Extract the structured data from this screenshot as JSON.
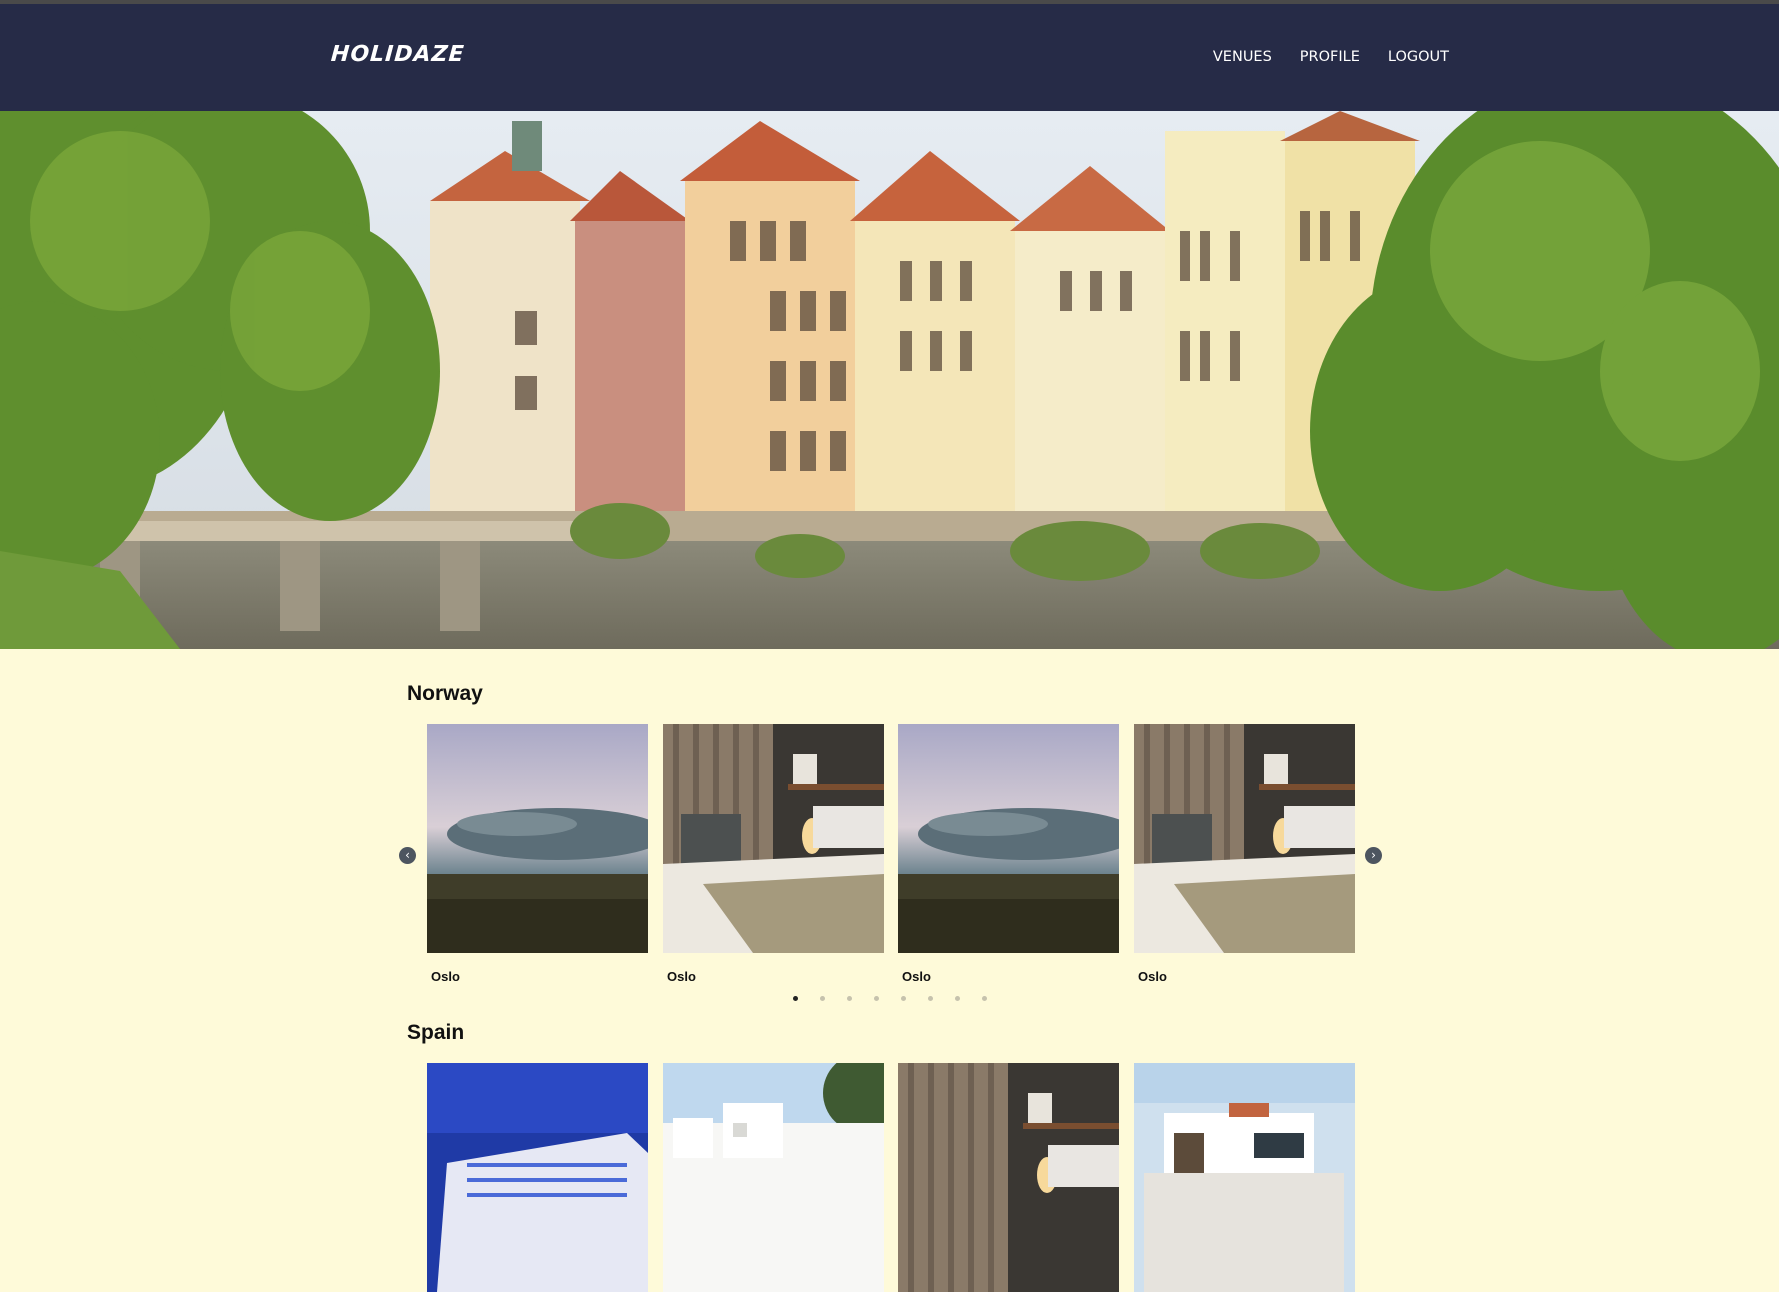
{
  "header": {
    "logo": "HOLIDAZE",
    "nav": [
      {
        "label": "VENUES"
      },
      {
        "label": "PROFILE"
      },
      {
        "label": "LOGOUT"
      }
    ]
  },
  "sections": [
    {
      "title": "Norway",
      "cards": [
        {
          "caption": "Oslo",
          "image": "stormy-field"
        },
        {
          "caption": "Oslo",
          "image": "hotel-bedroom"
        },
        {
          "caption": "Oslo",
          "image": "stormy-field"
        },
        {
          "caption": "Oslo",
          "image": "hotel-bedroom"
        }
      ],
      "carousel": {
        "page_count": 8,
        "active_page": 1
      }
    },
    {
      "title": "Spain",
      "cards": [
        {
          "image": "night-hotel"
        },
        {
          "image": "white-villa"
        },
        {
          "image": "hotel-bedroom"
        },
        {
          "image": "modern-house"
        }
      ]
    }
  ],
  "icons": {
    "prev": "chevron-left-icon",
    "next": "chevron-right-icon"
  },
  "colors": {
    "navbar": "#262b47",
    "page_background": "#fefad9",
    "arrow": "#4d5560"
  }
}
